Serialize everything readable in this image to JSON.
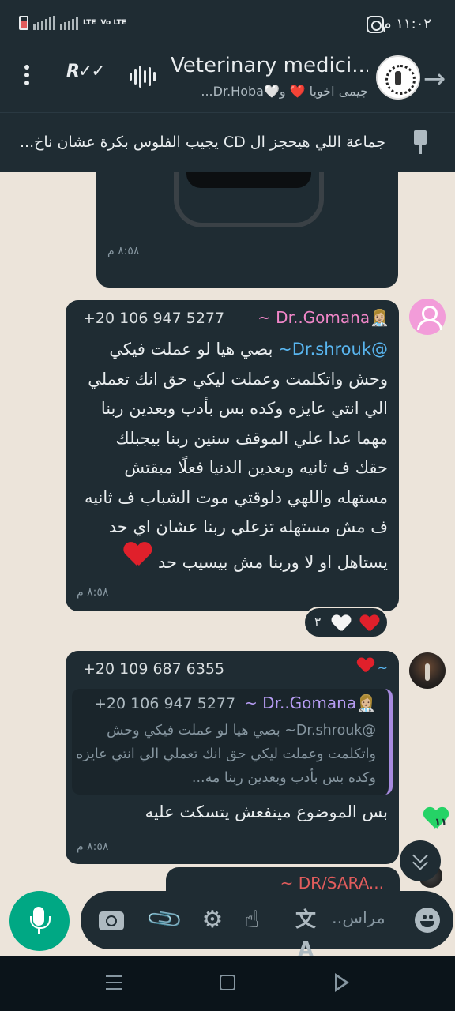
{
  "status_bar": {
    "time": "١١:٠٢ م",
    "network": "LTE",
    "volte": "Vo LTE"
  },
  "header": {
    "title": "Veterinary medici...",
    "subtitle": "جيمى اخويا ❤️ و🤍Dr.Hoba..."
  },
  "pinned": {
    "text": "جماعة اللي هيحجز ال CD يجيب الفلوس بكرة عشان ناخ..."
  },
  "messages": [
    {
      "type": "image",
      "time": "٨:٥٨ م"
    },
    {
      "sender_name": "~ Dr..Gomana👩🏼‍⚕️",
      "sender_phone": "+20 106 947 5277",
      "mention": "@Dr.shrouk~",
      "text": " بصي هيا لو عملت فيكي وحش  واتكلمت وعملت ليكي حق انك تعملي الي انتي عايزه وكده بس بأدب وبعدين ربنا مهما عدا علي الموقف سنين ربنا بيجبلك حقك ف ثانيه وبعدين الدنيا فعلًا مبقتش مستهله واللهي دلوقتي موت الشباب ف ثانيه ف مش مستهله تزعلي ربنا عشان اي حد يستاهل او لا وربنا مش بيسيب حد",
      "time": "٨:٥٨ م",
      "reactions": {
        "count": "٣"
      }
    },
    {
      "sender_phone": "+20 109 687 6355",
      "sender_name": "~",
      "quote": {
        "name": "~ Dr..Gomana👩🏼‍⚕️",
        "phone": "+20 106 947 5277",
        "text": "@Dr.shrouk~ بصي هيا لو عملت فيكي وحش  واتكلمت وعملت ليكي حق انك تعملي الي انتي عايزه وكده بس بأدب وبعدين ربنا مه..."
      },
      "text": "بس الموضوع مينفعش يتسكت عليه",
      "time": "٨:٥٨ م"
    },
    {
      "sender_name": "~ DR/SARA...",
      "partial": true
    }
  ],
  "unread_count": "١١",
  "composer": {
    "placeholder": "مراس.."
  },
  "colors": {
    "bubble": "#1f2c33",
    "accent": "#00a884",
    "chat_bg": "#ece4da"
  }
}
